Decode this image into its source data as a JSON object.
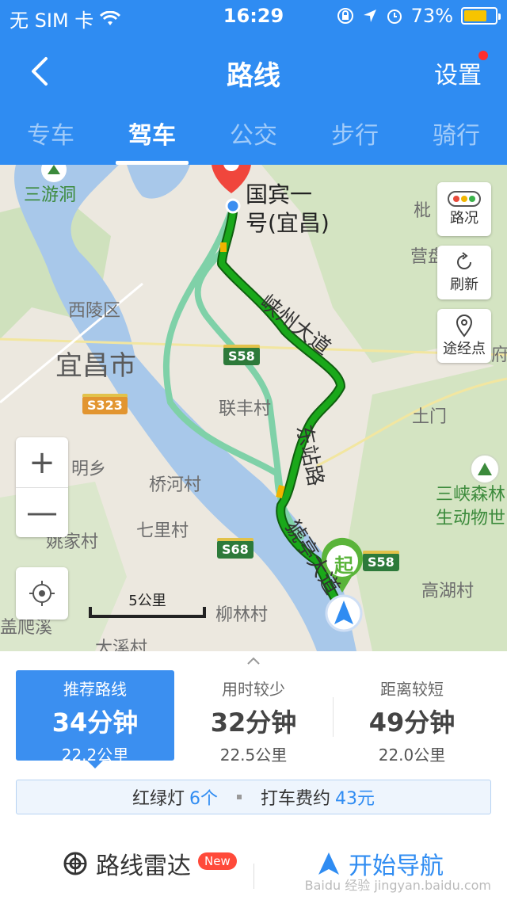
{
  "status": {
    "carrier": "无 SIM 卡",
    "time": "16:29",
    "battery": "73%",
    "battery_level": 0.73
  },
  "titlebar": {
    "title": "路线",
    "settings": "设置"
  },
  "modes": [
    "专车",
    "驾车",
    "公交",
    "步行",
    "骑行"
  ],
  "map": {
    "labels": {
      "sanyoudong": "三游洞",
      "xilingqu": "西陵区",
      "yichangshi": "宜昌市",
      "lianfengcun": "联丰村",
      "qiaohecun": "桥河村",
      "qilicun": "七里村",
      "yaojiacun": "姚家村",
      "liulincun": "柳林村",
      "daxicun": "大溪村",
      "tumen": "土门",
      "gaohucun": "高湖村",
      "xiang": "明乡",
      "pi": "枇",
      "yingshan": "营盘",
      "fu": "府",
      "zoo": "三峡森林\n生动物世",
      "guobin": "国宾一\n号(宜昌)",
      "road1": "峡州大道",
      "road2": "东站路",
      "road3": "猇亭大道",
      "start": "起",
      "bottomleft": "盖爬溪"
    },
    "badges": {
      "s58a": "S58",
      "s323": "S323",
      "s68": "S68",
      "s58b": "S58"
    },
    "controls": {
      "traffic": "路况",
      "refresh": "刷新",
      "waypoint": "途经点",
      "zoom_in": "+",
      "zoom_out": "—"
    },
    "scale": "5公里"
  },
  "routes": [
    {
      "label": "推荐路线",
      "time": "34分钟",
      "distance": "22.2公里"
    },
    {
      "label": "用时较少",
      "time": "32分钟",
      "distance": "22.5公里"
    },
    {
      "label": "距离较短",
      "time": "49分钟",
      "distance": "22.0公里"
    }
  ],
  "info": {
    "lights_label": "红绿灯",
    "lights_value": "6个",
    "fare_label": "打车费约",
    "fare_value": "43元"
  },
  "actions": {
    "radar": "路线雷达",
    "radar_badge": "New",
    "navigate": "开始导航"
  },
  "watermark": "Baidu 经验 jingyan.baidu.com",
  "colors": {
    "brand": "#2f8cf2",
    "route_main": "#1aa81a",
    "route_alt": "#7fd1a8",
    "river": "#a8c8ea"
  }
}
